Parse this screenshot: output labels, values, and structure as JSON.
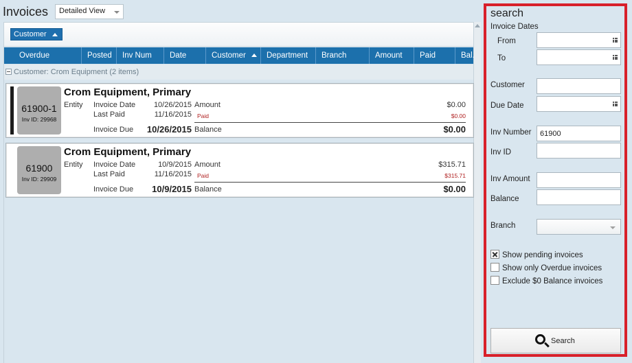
{
  "header": {
    "title": "Invoices",
    "view_selector": "Detailed View"
  },
  "group_chip": {
    "label": "Customer"
  },
  "columns": [
    "Overdue",
    "Posted",
    "Inv Num",
    "Date",
    "Customer",
    "Department",
    "Branch",
    "Amount",
    "Paid",
    "Bal..."
  ],
  "group_row": "Customer: Crom Equipment (2 items)",
  "records": [
    {
      "tile_num": "61900-1",
      "tile_invid": "Inv ID: 29968",
      "name": "Crom Equipment, Primary",
      "entity_label": "Entity",
      "invoice_date_label": "Invoice Date",
      "invoice_date": "10/26/2015",
      "amount_label": "Amount",
      "amount": "$0.00",
      "last_paid_label": "Last Paid",
      "last_paid": "11/16/2015",
      "paid_label": "Paid",
      "paid": "$0.00",
      "invoice_due_label": "Invoice Due",
      "invoice_due": "10/26/2015",
      "balance_label": "Balance",
      "balance": "$0.00"
    },
    {
      "tile_num": "61900",
      "tile_invid": "Inv ID: 29909",
      "name": "Crom Equipment, Primary",
      "entity_label": "Entity",
      "invoice_date_label": "Invoice Date",
      "invoice_date": "10/9/2015",
      "amount_label": "Amount",
      "amount": "$315.71",
      "last_paid_label": "Last Paid",
      "last_paid": "11/16/2015",
      "paid_label": "Paid",
      "paid": "$315.71",
      "invoice_due_label": "Invoice Due",
      "invoice_due": "10/9/2015",
      "balance_label": "Balance",
      "balance": "$0.00"
    }
  ],
  "search": {
    "title": "search",
    "invoice_dates_label": "Invoice Dates",
    "from_label": "From",
    "from_value": "",
    "to_label": "To",
    "to_value": "",
    "customer_label": "Customer",
    "customer_value": "",
    "due_date_label": "Due Date",
    "due_date_value": "",
    "inv_number_label": "Inv Number",
    "inv_number_value": "61900",
    "inv_id_label": "Inv ID",
    "inv_id_value": "",
    "inv_amount_label": "Inv Amount",
    "inv_amount_value": "",
    "balance_label": "Balance",
    "balance_value": "",
    "branch_label": "Branch",
    "branch_value": "",
    "checkboxes": [
      {
        "label": "Show pending invoices",
        "checked": true
      },
      {
        "label": "Show only Overdue invoices",
        "checked": false
      },
      {
        "label": "Exclude $0 Balance invoices",
        "checked": false
      }
    ],
    "button_label": "Search"
  },
  "colors": {
    "accent": "#1c70ac",
    "highlight_border": "#d8202a",
    "paid_text": "#b02020"
  }
}
